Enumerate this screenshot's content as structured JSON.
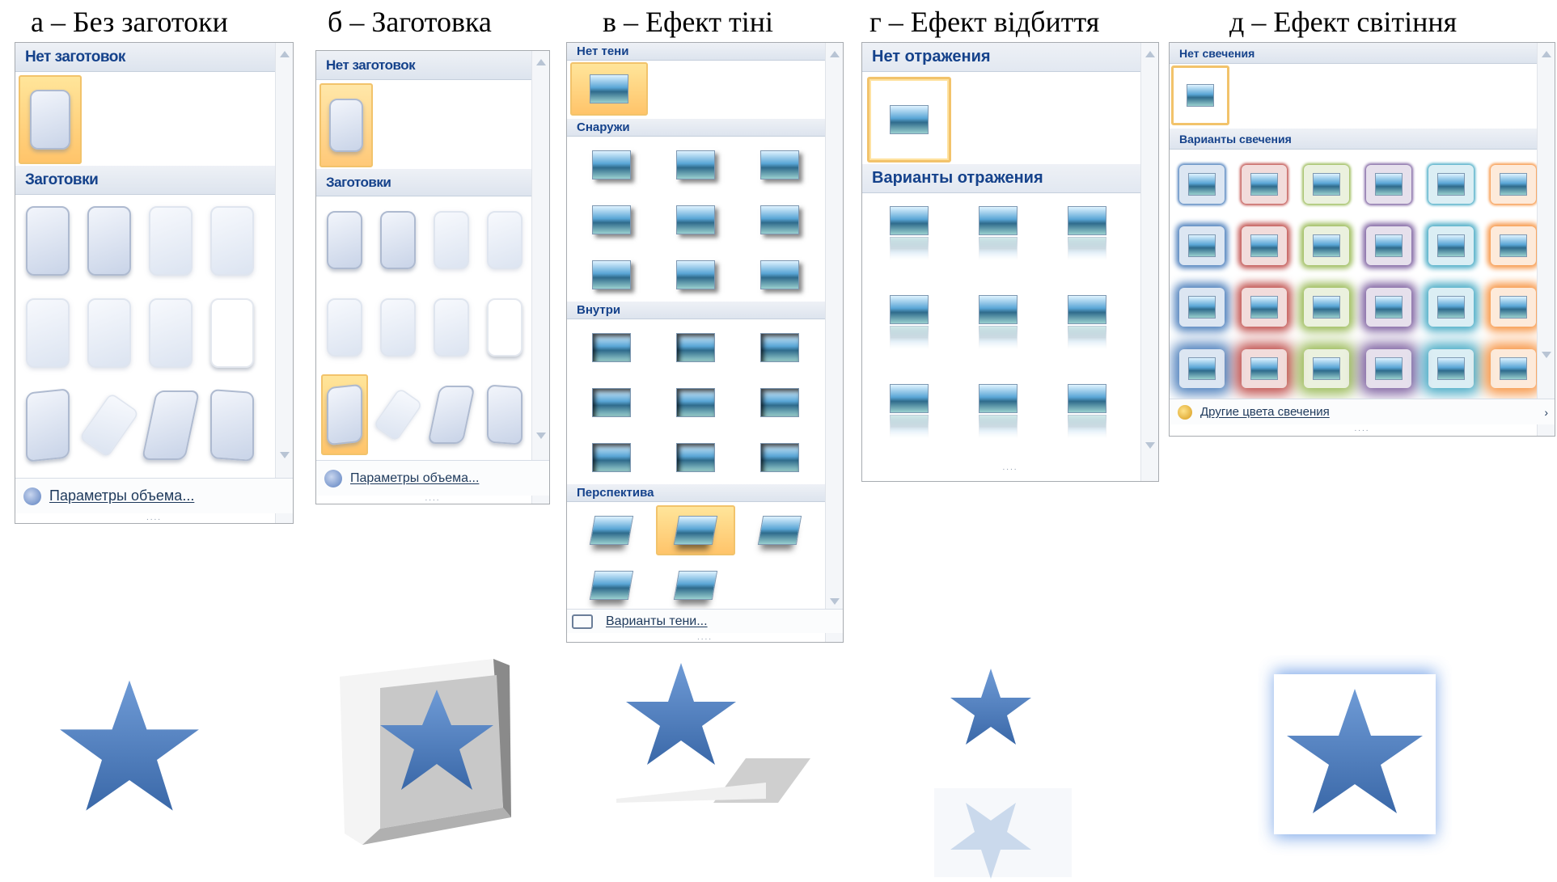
{
  "captions": {
    "a": "а – Без заготоки",
    "b": "б – Заготовка",
    "c": "в – Ефект тіні",
    "d": "г – Ефект відбиття",
    "e": "д – Ефект світіння"
  },
  "bevel_panel": {
    "none_header": "Нет заготовок",
    "presets_header": "Заготовки",
    "footer": "Параметры объема...",
    "grip": "....",
    "selected_in_a": "none",
    "selected_in_b": "row3-col1"
  },
  "shadow_panel": {
    "none_header": "Нет тени",
    "outer_header": "Снаружи",
    "inner_header": "Внутри",
    "persp_header": "Перспектива",
    "footer": "Варианты тени...",
    "grip": "....",
    "selected": "perspective-2"
  },
  "reflection_panel": {
    "none_header": "Нет отражения",
    "variants_header": "Варианты отражения",
    "grip": "...."
  },
  "glow_panel": {
    "none_header": "Нет свечения",
    "variants_header": "Варианты свечения",
    "footer": "Другие цвета свечения",
    "grip": "....",
    "colors": [
      "#4f81bd",
      "#c0504d",
      "#9bbb59",
      "#8064a2",
      "#4bacc6",
      "#f79646"
    ]
  },
  "colors": {
    "star": "#4f7fbf",
    "selection": "#ffc46a",
    "header_text": "#15428b"
  }
}
